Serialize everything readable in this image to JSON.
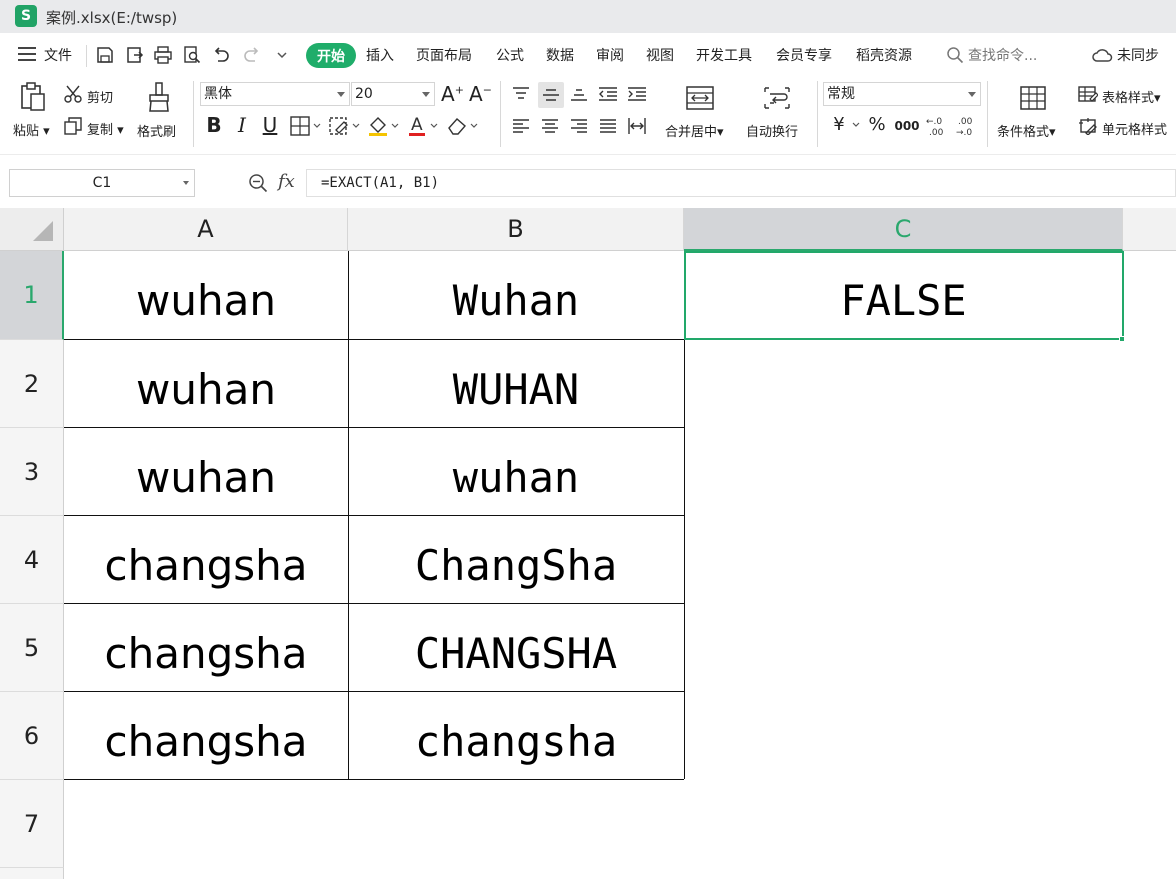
{
  "window": {
    "logo": "S",
    "title": "案例.xlsx(E:/twsp)"
  },
  "menu": {
    "file": "文件",
    "tabs": [
      "开始",
      "插入",
      "页面布局",
      "公式",
      "数据",
      "审阅",
      "视图",
      "开发工具",
      "会员专享",
      "稻壳资源"
    ],
    "search_placeholder": "查找命令...",
    "sync": "未同步"
  },
  "ribbon": {
    "paste": "粘贴",
    "cut": "剪切",
    "copy": "复制",
    "format_painter": "格式刷",
    "font_name": "黑体",
    "font_size": "20",
    "merge_center": "合并居中",
    "wrap_text": "自动换行",
    "number_format": "常规",
    "conditional_format": "条件格式",
    "table_style": "表格样式",
    "cell_style": "单元格样式"
  },
  "formula_bar": {
    "name_box": "C1",
    "fx": "fx",
    "formula": "=EXACT(A1, B1)"
  },
  "sheet": {
    "columns": [
      "A",
      "B",
      "C"
    ],
    "rows": [
      "1",
      "2",
      "3",
      "4",
      "5",
      "6",
      "7"
    ],
    "selected_cell": "C1",
    "cells": {
      "A": [
        "wuhan",
        "wuhan",
        "wuhan",
        "changsha",
        "changsha",
        "changsha"
      ],
      "B": [
        "Wuhan",
        "WUHAN",
        "wuhan",
        "ChangSha",
        "CHANGSHA",
        "changsha"
      ],
      "C1": "FALSE"
    }
  },
  "colors": {
    "accent": "#1fad6a",
    "selected_header": "#d3d5d8"
  }
}
